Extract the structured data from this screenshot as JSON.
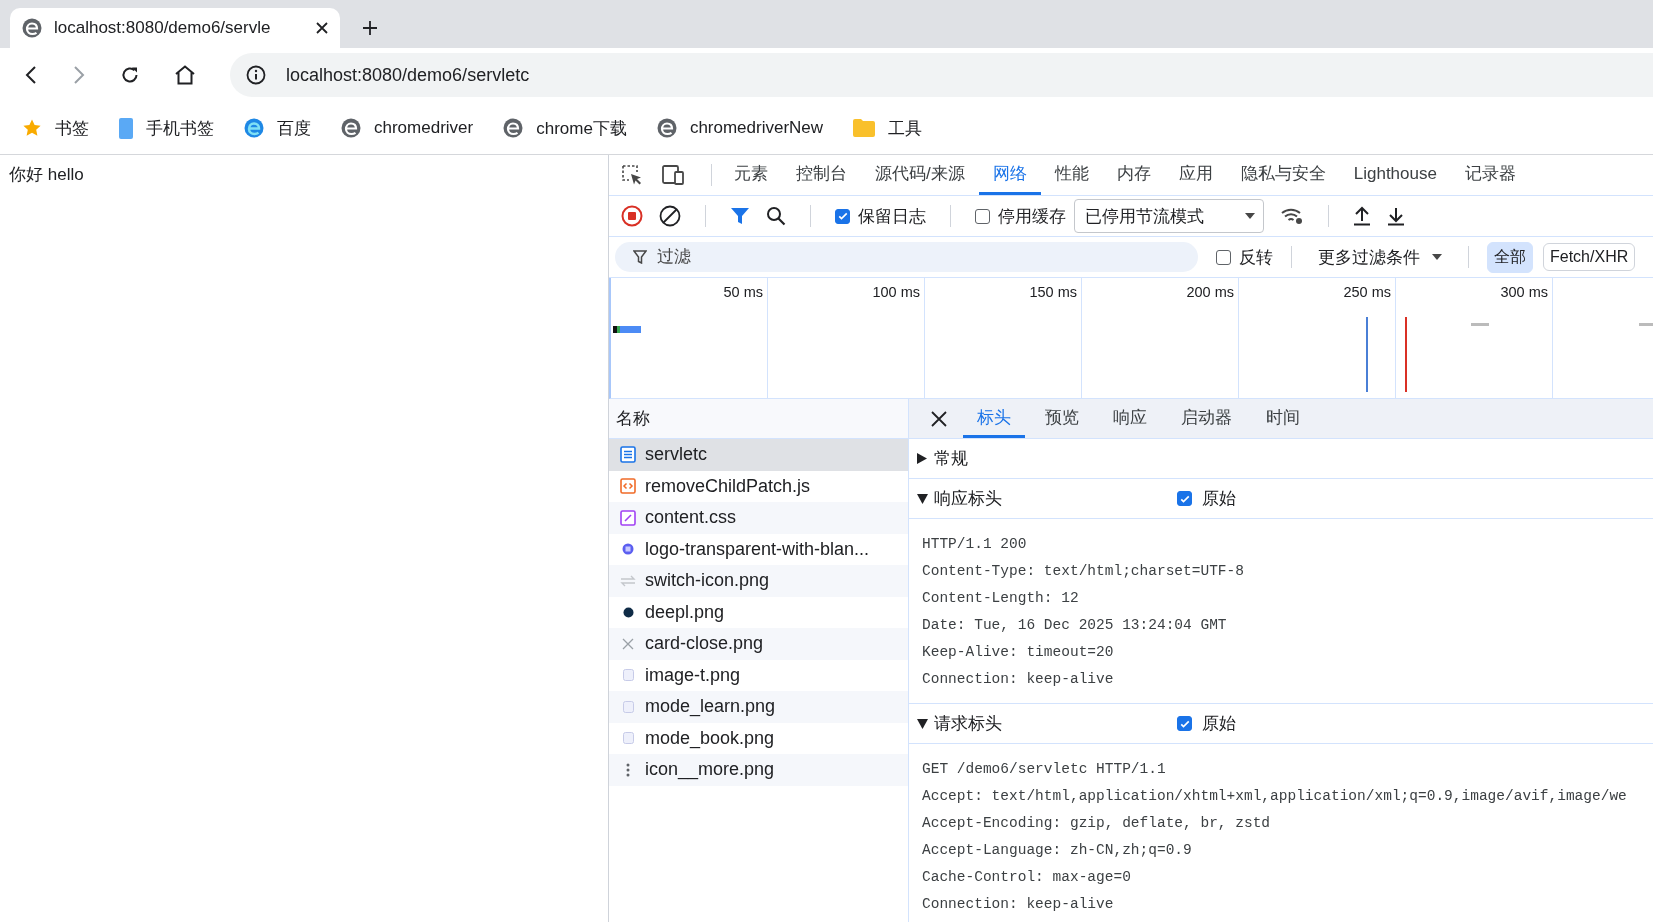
{
  "browser": {
    "tab": {
      "title": "localhost:8080/demo6/servle"
    },
    "url": "localhost:8080/demo6/servletc",
    "bookmarks": [
      {
        "label": "书签",
        "kind": "star"
      },
      {
        "label": "手机书签",
        "kind": "phone"
      },
      {
        "label": "百度",
        "kind": "edge"
      },
      {
        "label": "chromedriver",
        "kind": "site"
      },
      {
        "label": "chrome下载",
        "kind": "site"
      },
      {
        "label": "chromedriverNew",
        "kind": "site"
      },
      {
        "label": "工具",
        "kind": "folder"
      }
    ]
  },
  "page": {
    "text": "你好 hello"
  },
  "devtools": {
    "panel_tabs": [
      {
        "label": "元素",
        "selected": false
      },
      {
        "label": "控制台",
        "selected": false
      },
      {
        "label": "源代码/来源",
        "selected": false
      },
      {
        "label": "网络",
        "selected": true
      },
      {
        "label": "性能",
        "selected": false
      },
      {
        "label": "内存",
        "selected": false
      },
      {
        "label": "应用",
        "selected": false
      },
      {
        "label": "隐私与安全",
        "selected": false
      },
      {
        "label": "Lighthouse",
        "selected": false
      },
      {
        "label": "记录器",
        "selected": false
      }
    ],
    "toolbar": {
      "recording": true,
      "preserve_log": {
        "label": "保留日志",
        "checked": true
      },
      "disable_cache": {
        "label": "停用缓存",
        "checked": false
      },
      "throttling": "已停用节流模式"
    },
    "filter": {
      "placeholder": "过滤",
      "invert": {
        "label": "反转",
        "checked": false
      },
      "more_filters": "更多过滤条件",
      "type_buttons": [
        {
          "label": "全部",
          "selected": true
        },
        {
          "label": "Fetch/XHR",
          "selected": false
        }
      ]
    },
    "timeline": {
      "ticks": [
        "50 ms",
        "100 ms",
        "150 ms",
        "200 ms",
        "250 ms",
        "300 ms"
      ]
    },
    "requests": {
      "column": "名称",
      "rows": [
        {
          "name": "servletc",
          "kind": "document",
          "selected": true
        },
        {
          "name": "removeChildPatch.js",
          "kind": "script",
          "selected": false
        },
        {
          "name": "content.css",
          "kind": "stylesheet",
          "selected": false
        },
        {
          "name": "logo-transparent-with-blan...",
          "kind": "logo",
          "selected": false
        },
        {
          "name": "switch-icon.png",
          "kind": "arrows",
          "selected": false
        },
        {
          "name": "deepl.png",
          "kind": "dark-dot",
          "selected": false
        },
        {
          "name": "card-close.png",
          "kind": "cross",
          "selected": false
        },
        {
          "name": "image-t.png",
          "kind": "image",
          "selected": false
        },
        {
          "name": "mode_learn.png",
          "kind": "image",
          "selected": false
        },
        {
          "name": "mode_book.png",
          "kind": "image",
          "selected": false
        },
        {
          "name": "icon__more.png",
          "kind": "dots",
          "selected": false
        }
      ]
    },
    "detail_tabs": [
      {
        "label": "标头",
        "selected": true
      },
      {
        "label": "预览",
        "selected": false
      },
      {
        "label": "响应",
        "selected": false
      },
      {
        "label": "启动器",
        "selected": false
      },
      {
        "label": "时间",
        "selected": false
      }
    ],
    "sections": [
      {
        "title": "常规",
        "expanded": false
      },
      {
        "title": "响应标头",
        "expanded": true,
        "raw": {
          "label": "原始",
          "checked": true
        },
        "lines": [
          "HTTP/1.1 200",
          "Content-Type: text/html;charset=UTF-8",
          "Content-Length: 12",
          "Date: Tue, 16 Dec 2025 13:24:04 GMT",
          "Keep-Alive: timeout=20",
          "Connection: keep-alive"
        ]
      },
      {
        "title": "请求标头",
        "expanded": true,
        "raw": {
          "label": "原始",
          "checked": true
        },
        "lines": [
          "GET /demo6/servletc HTTP/1.1",
          "Accept: text/html,application/xhtml+xml,application/xml;q=0.9,image/avif,image/we",
          "Accept-Encoding: gzip, deflate, br, zstd",
          "Accept-Language: zh-CN,zh;q=0.9",
          "Cache-Control: max-age=0",
          "Connection: keep-alive"
        ]
      }
    ]
  }
}
